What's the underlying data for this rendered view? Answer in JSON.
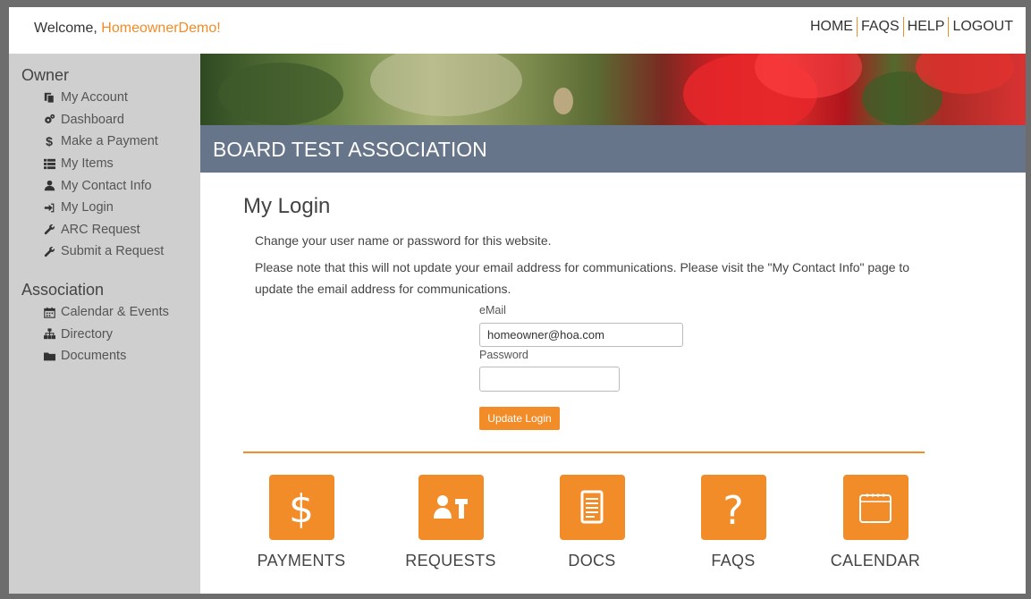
{
  "header": {
    "welcome_prefix": "Welcome, ",
    "username": "HomeownerDemo!",
    "nav": [
      "HOME",
      "FAQS",
      "HELP",
      "LOGOUT"
    ]
  },
  "sidebar": {
    "owner_title": "Owner",
    "owner_items": [
      {
        "label": "My Account",
        "icon": "copy-icon"
      },
      {
        "label": "Dashboard",
        "icon": "cogs-icon"
      },
      {
        "label": "Make a Payment",
        "icon": "dollar-icon"
      },
      {
        "label": "My Items",
        "icon": "list-icon"
      },
      {
        "label": "My Contact Info",
        "icon": "user-icon"
      },
      {
        "label": "My Login",
        "icon": "sign-in-icon"
      },
      {
        "label": "ARC Request",
        "icon": "wrench-icon"
      },
      {
        "label": "Submit a Request",
        "icon": "wrench-icon"
      }
    ],
    "association_title": "Association",
    "association_items": [
      {
        "label": "Calendar & Events",
        "icon": "calendar-icon"
      },
      {
        "label": "Directory",
        "icon": "sitemap-icon"
      },
      {
        "label": "Documents",
        "icon": "folder-icon"
      }
    ]
  },
  "banner": {
    "association_name": "BOARD TEST ASSOCIATION"
  },
  "main": {
    "title": "My Login",
    "intro": "Change your user name or password for this website.",
    "note": "Please note that this will not update your email address for communications. Please visit the \"My Contact Info\" page to update the email address for communications.",
    "email_label": "eMail",
    "email_value": "homeowner@hoa.com",
    "password_label": "Password",
    "password_value": "",
    "button_label": "Update Login"
  },
  "tiles": [
    {
      "label": "PAYMENTS",
      "icon": "dollar-icon"
    },
    {
      "label": "REQUESTS",
      "icon": "user-wrench-icon"
    },
    {
      "label": "DOCS",
      "icon": "document-icon"
    },
    {
      "label": "FAQS",
      "icon": "question-icon"
    },
    {
      "label": "CALENDAR",
      "icon": "calendar-icon"
    }
  ],
  "colors": {
    "accent": "#f28c28",
    "band": "#67758a",
    "sidebar": "#cfcfcf"
  }
}
